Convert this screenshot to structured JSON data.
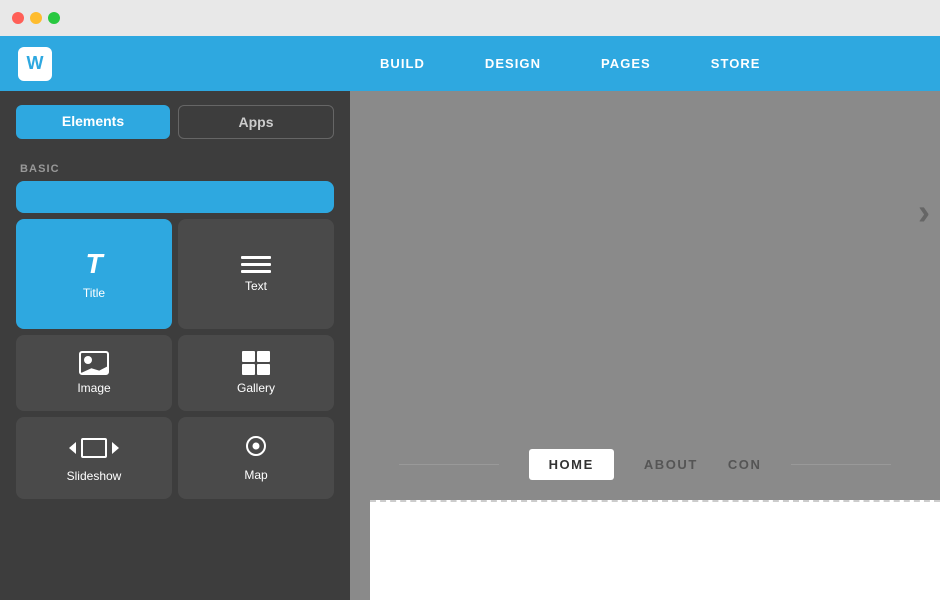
{
  "titlebar": {
    "dots": [
      "red",
      "yellow",
      "green"
    ]
  },
  "navbar": {
    "logo_text": "W",
    "tabs": [
      {
        "id": "build",
        "label": "BUILD"
      },
      {
        "id": "design",
        "label": "DESIGN"
      },
      {
        "id": "pages",
        "label": "PAGES"
      },
      {
        "id": "store",
        "label": "STORE"
      }
    ]
  },
  "sidebar": {
    "tabs": [
      {
        "id": "elements",
        "label": "Elements",
        "active": true
      },
      {
        "id": "apps",
        "label": "Apps",
        "active": false
      }
    ],
    "section_label": "BASIC",
    "elements": [
      {
        "id": "title",
        "label": "Title",
        "icon": "T"
      },
      {
        "id": "text",
        "label": "Text",
        "icon": "lines"
      },
      {
        "id": "image",
        "label": "Image",
        "icon": "image"
      },
      {
        "id": "gallery",
        "label": "Gallery",
        "icon": "gallery"
      },
      {
        "id": "slideshow",
        "label": "Slideshow",
        "icon": "slideshow"
      },
      {
        "id": "map",
        "label": "Map",
        "icon": "map"
      }
    ]
  },
  "canvas": {
    "site_nav_items": [
      {
        "label": "HOME",
        "active": true
      },
      {
        "label": "ABOUT",
        "active": false
      },
      {
        "label": "CON",
        "active": false
      }
    ]
  },
  "colors": {
    "blue_accent": "#2ea8e0",
    "sidebar_bg": "#3d3d3d",
    "element_bg": "#4a4a4a",
    "canvas_bg": "#8a8a8a"
  }
}
